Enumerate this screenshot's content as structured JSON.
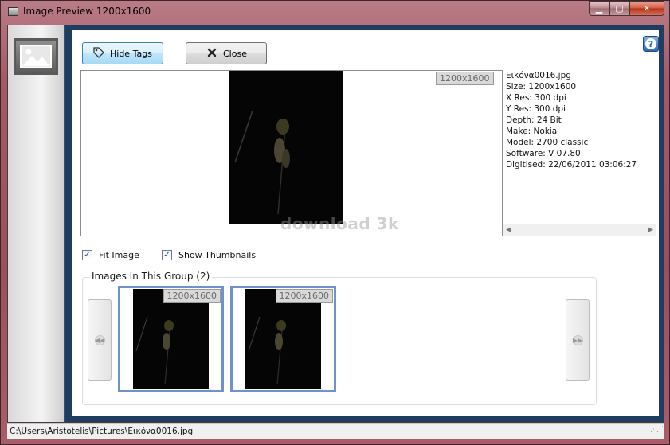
{
  "window": {
    "title": "Image Preview 1200x1600",
    "caption_buttons": {
      "minimize": "▁",
      "maximize": "▢",
      "close": "✕"
    }
  },
  "toolbar": {
    "hide_tags_label": "Hide Tags",
    "close_label": "Close",
    "help_label": "?"
  },
  "preview": {
    "resolution_badge": "1200x1600",
    "watermark": "download 3k"
  },
  "info": {
    "lines": [
      "Εικόνα0016.jpg",
      "Size: 1200x1600",
      "X Res: 300 dpi",
      "Y Res: 300 dpi",
      "Depth: 24 Bit",
      "Make: Nokia",
      "Model: 2700 classic",
      "Software: V 07.80",
      "Digitised: 22/06/2011 03:06:27"
    ]
  },
  "options": {
    "fit_image": {
      "label": "Fit Image",
      "checked": true
    },
    "show_thumbnails": {
      "label": "Show Thumbnails",
      "checked": true
    }
  },
  "group": {
    "title": "Images In This Group (2)",
    "thumbnails": [
      {
        "badge": "1200x1600"
      },
      {
        "badge": "1200x1600"
      }
    ]
  },
  "statusbar": {
    "path": "C:\\Users\\Aristotelis\\Pictures\\Εικόνα0016.jpg"
  },
  "colors": {
    "accent": "#3c7fb1",
    "thumb_border": "#6f92cc",
    "frame": "#9c4f5b"
  }
}
